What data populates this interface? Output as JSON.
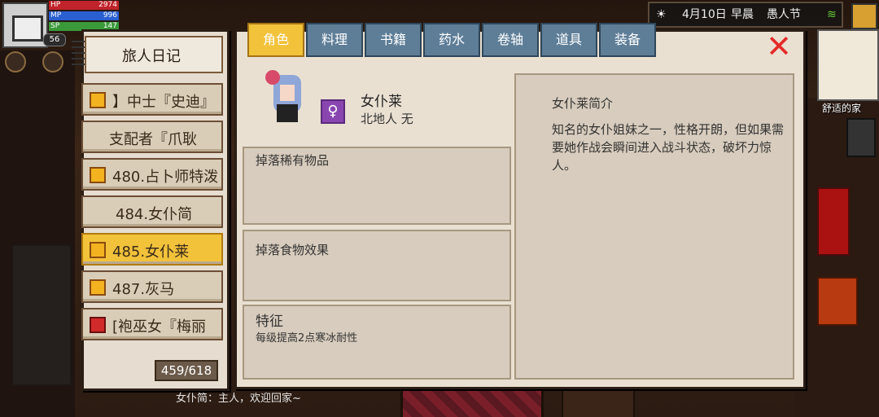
{
  "hud": {
    "hp_label": "HP",
    "hp_value": "2974",
    "mp_label": "MP",
    "mp_value": "996",
    "sp_label": "SP",
    "sp_value": "147",
    "level": "56"
  },
  "top_right": {
    "date": "4月10日",
    "time_of_day": "早晨",
    "festival": "愚人节",
    "location_label": "舒适的家"
  },
  "journal": {
    "title": "旅人日记",
    "items": [
      {
        "label": "】中士『史迪』",
        "gem": "gold"
      },
      {
        "label": "支配者『爪耿",
        "gem": "none"
      },
      {
        "label": "480.占卜师特泼",
        "gem": "gold"
      },
      {
        "label": "484.女仆简",
        "gem": "none"
      },
      {
        "label": "485.女仆莱",
        "gem": "gold",
        "selected": true
      },
      {
        "label": "487.灰马",
        "gem": "gold"
      },
      {
        "label": "[袍巫女『梅丽",
        "gem": "red"
      }
    ],
    "counter": "459/618"
  },
  "tabs": [
    "角色",
    "料理",
    "书籍",
    "药水",
    "卷轴",
    "道具",
    "装备"
  ],
  "active_tab": 0,
  "npc": {
    "name": "女仆莱",
    "origin": "北地人 无",
    "gender_icon": "♀",
    "sections": {
      "rare_drop_title": "掉落稀有物品",
      "food_effect_title": "掉落食物效果",
      "trait_title": "特征",
      "trait_desc": "每级提高2点寒冰耐性"
    },
    "intro_title": "女仆莱简介",
    "intro_text": "知名的女仆姐妹之一，性格开朗，但如果需要她作战会瞬间进入战斗状态，破坏力惊人。"
  },
  "dialog_line": "女仆简：主人，欢迎回家~",
  "colors": {
    "accent_gold": "#f2c23a",
    "tab_blue": "#5e7e98",
    "close_red": "#e42a2a",
    "hp": "#c0232a",
    "mp": "#2a5fd0",
    "sp": "#3a9a3a"
  },
  "icons": {
    "close": "close-icon",
    "gender": "female-icon",
    "gem": "gem-icon",
    "sun": "sun-icon",
    "wifi": "wifi-icon"
  }
}
